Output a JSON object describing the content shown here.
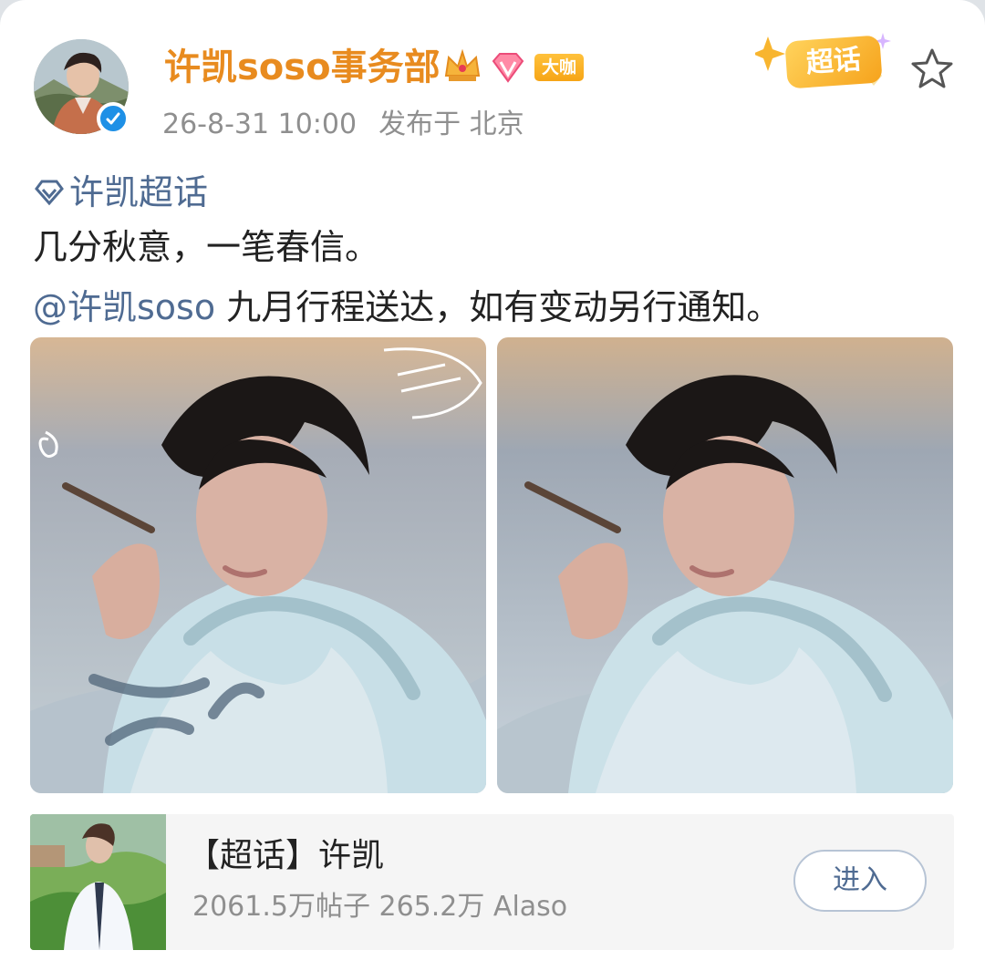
{
  "post": {
    "author_name": "许凯soso事务部",
    "badge_label": "大咖",
    "date": "26-8-31 10:00",
    "location": "发布于 北京",
    "supertopic_badge": "超话",
    "topic_tag": "许凯超话",
    "text_line_1": "几分秋意，一笔春信。",
    "mention": "@许凯soso",
    "text_line_2": "九月行程送达，如有变动另行通知。"
  },
  "topic_card": {
    "title": "【超话】许凯",
    "stats": "2061.5万帖子 265.2万 Alaso",
    "enter_label": "进入"
  },
  "colors": {
    "author": "#e88b1f",
    "link": "#4f6b92",
    "meta": "#8f8f8f",
    "verified": "#1e90e6",
    "daka": "#f6a516"
  },
  "icons": [
    "avatar",
    "verified-icon",
    "crown-icon",
    "fan-icon",
    "supertopic-badge",
    "star-icon",
    "supertopic-icon"
  ]
}
